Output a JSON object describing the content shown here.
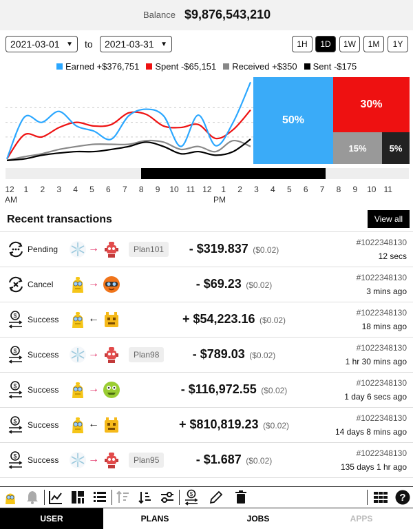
{
  "balance": {
    "label": "Balance",
    "value": "$9,876,543,210"
  },
  "date_range": {
    "from": "2021-03-01",
    "to_label": "to",
    "to": "2021-03-31"
  },
  "range_buttons": [
    "1H",
    "1D",
    "1W",
    "1M",
    "1Y"
  ],
  "range_active": "1D",
  "legend": [
    {
      "label": "Earned +$376,751",
      "color": "#2ba7ff"
    },
    {
      "label": "Spent -$65,151",
      "color": "#ee1111"
    },
    {
      "label": "Received +$350",
      "color": "#888888"
    },
    {
      "label": "Sent -$175",
      "color": "#000000"
    }
  ],
  "chart_data": {
    "type": "line",
    "x": [
      "12 AM",
      "1",
      "2",
      "3",
      "4",
      "5",
      "6",
      "7",
      "8",
      "9",
      "10",
      "11",
      "12 PM",
      "1",
      "2"
    ],
    "series": [
      {
        "name": "Earned",
        "color": "#2ba7ff",
        "values": [
          5,
          62,
          55,
          70,
          50,
          43,
          32,
          64,
          73,
          64,
          22,
          65,
          23,
          55,
          110
        ]
      },
      {
        "name": "Spent",
        "color": "#ee1111",
        "values": [
          5,
          38,
          35,
          48,
          55,
          50,
          52,
          68,
          66,
          50,
          48,
          52,
          33,
          45,
          72
        ]
      },
      {
        "name": "Received",
        "color": "#888888",
        "values": [
          3,
          8,
          12,
          18,
          22,
          25,
          25,
          25,
          30,
          28,
          18,
          22,
          15,
          30,
          22
        ]
      },
      {
        "name": "Sent",
        "color": "#000000",
        "values": [
          3,
          5,
          10,
          13,
          15,
          15,
          18,
          22,
          28,
          22,
          12,
          15,
          10,
          15,
          32
        ]
      }
    ],
    "ylim": [
      0,
      115
    ],
    "grid": true,
    "legend_position": "top"
  },
  "treemap": [
    {
      "label": "50%",
      "color": "#3aabf8",
      "value": 50
    },
    {
      "label": "30%",
      "color": "#ee1111",
      "value": 30
    },
    {
      "label": "15%",
      "color": "#999999",
      "value": 15
    },
    {
      "label": "5%",
      "color": "#222222",
      "value": 5
    }
  ],
  "time_axis": {
    "ticks": [
      "12",
      "1",
      "2",
      "3",
      "4",
      "5",
      "6",
      "7",
      "8",
      "9",
      "10",
      "11",
      "12",
      "1",
      "2",
      "3",
      "4",
      "5",
      "6",
      "7",
      "8",
      "9",
      "10",
      "11"
    ],
    "am_label": "AM",
    "pm_label": "PM"
  },
  "recent": {
    "title": "Recent transactions",
    "view_all": "View all"
  },
  "transactions": [
    {
      "status": "Pending",
      "status_icon": "pending-icon",
      "from": "snowflake",
      "to": "red-robot",
      "arrow": "→",
      "plan": "Plan101",
      "amount": "- $319.837",
      "fee": "($0.02)",
      "id": "#1022348130",
      "time": "12 secs"
    },
    {
      "status": "Cancel",
      "status_icon": "cancel-icon",
      "from": "yellow-bot",
      "to": "orange-goggles",
      "arrow": "→",
      "plan": "",
      "amount": "- $69.23",
      "fee": "($0.02)",
      "id": "#1022348130",
      "time": "3 mins ago"
    },
    {
      "status": "Success",
      "status_icon": "success-icon",
      "from": "yellow-bot",
      "to": "yellow-box-bot",
      "arrow": "←",
      "plan": "",
      "amount": "+ $54,223.16",
      "fee": "($0.02)",
      "id": "#1022348130",
      "time": "18 mins ago"
    },
    {
      "status": "Success",
      "status_icon": "success-icon",
      "from": "snowflake",
      "to": "red-robot",
      "arrow": "→",
      "plan": "Plan98",
      "amount": "- $789.03",
      "fee": "($0.02)",
      "id": "#1022348130",
      "time": "1 hr 30 mins ago"
    },
    {
      "status": "Success",
      "status_icon": "success-icon",
      "from": "yellow-bot",
      "to": "green-monster",
      "arrow": "→",
      "plan": "",
      "amount": "- $116,972.55",
      "fee": "($0.02)",
      "id": "#1022348130",
      "time": "1 day 6 secs ago"
    },
    {
      "status": "Success",
      "status_icon": "success-icon",
      "from": "yellow-bot",
      "to": "yellow-box-bot",
      "arrow": "←",
      "plan": "",
      "amount": "+ $810,819.23",
      "fee": "($0.02)",
      "id": "#1022348130",
      "time": "14 days 8 mins ago"
    },
    {
      "status": "Success",
      "status_icon": "success-icon",
      "from": "snowflake",
      "to": "red-robot",
      "arrow": "→",
      "plan": "Plan95",
      "amount": "- $1.687",
      "fee": "($0.02)",
      "id": "#1022348130",
      "time": "135 days 1 hr ago"
    }
  ],
  "toolbar_icons": [
    "avatar-icon",
    "bell-icon",
    "line-chart-icon",
    "treemap-icon",
    "list-icon",
    "sort-asc-icon",
    "sort-desc-icon",
    "filter-sliders-icon",
    "coin-transfer-icon",
    "pencil-icon",
    "trash-icon",
    "grid-icon",
    "help-icon"
  ],
  "nav_tabs": [
    {
      "label": "USER",
      "state": "active"
    },
    {
      "label": "PLANS",
      "state": "normal"
    },
    {
      "label": "JOBS",
      "state": "normal"
    },
    {
      "label": "APPS",
      "state": "disabled"
    }
  ]
}
